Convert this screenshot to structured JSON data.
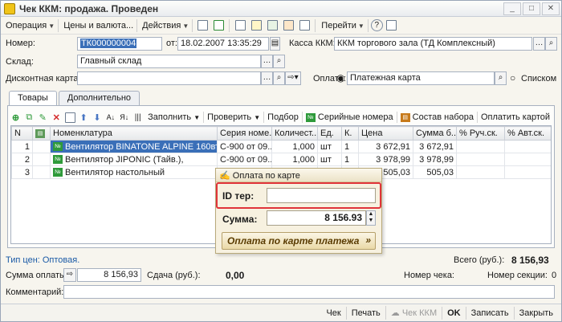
{
  "window": {
    "title": "Чек ККМ: продажа. Проведен"
  },
  "menu": [
    "Операция",
    "Цены и валюта...",
    "Действия",
    "Перейти"
  ],
  "form": {
    "number_label": "Номер:",
    "number_value": "ТК000000004",
    "date_label": "от:",
    "date_value": "18.02.2007 13:35:29",
    "kkm_label": "Касса ККМ:",
    "kkm_value": "ККМ торгового зала (ТД Комплексный)",
    "warehouse_label": "Склад:",
    "warehouse_value": "Главный склад",
    "discount_label": "Дисконтная карта:",
    "discount_value": "",
    "payment_label": "Оплата:",
    "payment_value": "Платежная карта",
    "payment_alt": "Списком"
  },
  "tabs": [
    "Товары",
    "Дополнительно"
  ],
  "toolbar2": [
    "Заполнить",
    "Проверить",
    "Подбор",
    "Серийные номера",
    "Состав набора",
    "Оплатить картой"
  ],
  "table": {
    "headers": [
      "N",
      "",
      "Номенклатура",
      "Серия номе...",
      "Количест...",
      "Ед.",
      "К.",
      "Цена",
      "Сумма б...",
      "% Руч.ск.",
      "% Авт.ск."
    ],
    "rows": [
      {
        "n": "1",
        "name": "Вентилятор BINATONE ALPINE 160вт, ...",
        "series": "С-900 от 09....",
        "qty": "1,000",
        "unit": "шт",
        "k": "1",
        "price": "3 672,91",
        "sum": "3 672,91"
      },
      {
        "n": "2",
        "name": "Вентилятор JIPONIC (Тайв.),",
        "series": "С-900 от 09....",
        "qty": "1,000",
        "unit": "шт",
        "k": "1",
        "price": "3 978,99",
        "sum": "3 978,99"
      },
      {
        "n": "3",
        "name": "Вентилятор настольный",
        "series": "",
        "qty": "",
        "unit": "",
        "k": "",
        "price": "505,03",
        "sum": "505,03"
      }
    ]
  },
  "dialog": {
    "title": "Оплата по карте",
    "id_label": "ID тер:",
    "id_value": "",
    "sum_label": "Сумма:",
    "sum_value": "8 156.93",
    "pay_button": "Оплата по карте платежа"
  },
  "summary": {
    "price_type": "Тип цен: Оптовая.",
    "total_label": "Всего (руб.):",
    "total_value": "8 156,93",
    "payment_sum_label": "Сумма оплаты:",
    "payment_sum_value": "8 156,93",
    "change_label": "Сдача (руб.):",
    "change_value": "0,00",
    "receipt_no_label": "Номер чека:",
    "section_no_label": "Номер секции:",
    "section_no_value": "0",
    "comment_label": "Комментарий:",
    "comment_value": ""
  },
  "bottom_buttons": [
    "Чек",
    "Печать",
    "Чек ККМ",
    "OK",
    "Записать",
    "Закрыть"
  ]
}
